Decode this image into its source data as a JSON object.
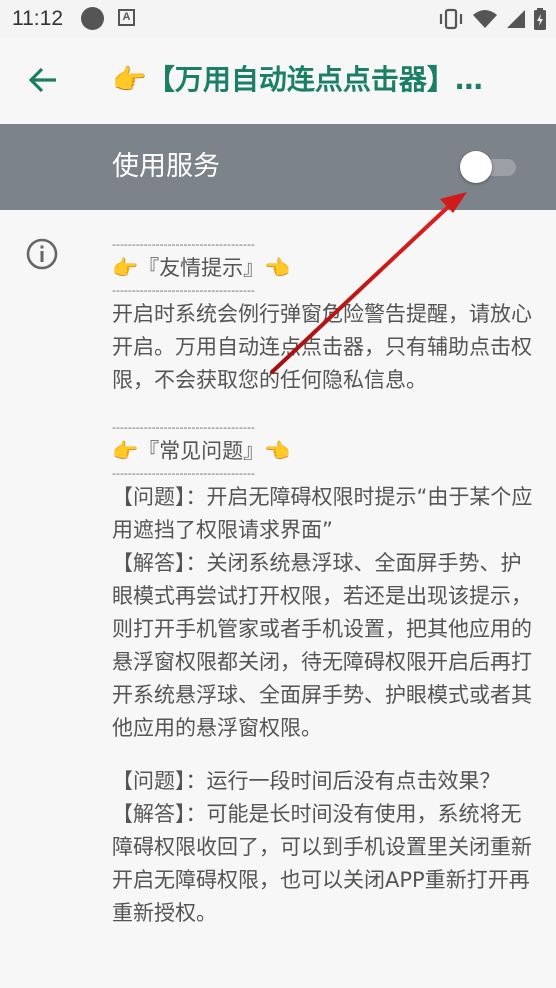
{
  "status_bar": {
    "time": "11:12",
    "icons": [
      "circle-notification-icon",
      "a-notification-icon",
      "vibrate-icon",
      "wifi-icon",
      "signal-icon",
      "battery-icon"
    ]
  },
  "app_bar": {
    "title": "👉【万用自动连点点击器】…",
    "back_icon": "arrow-back-icon"
  },
  "service": {
    "label": "使用服务",
    "enabled": false
  },
  "content": {
    "separator": "------------------------------------",
    "tip_heading": "👉『友情提示』👈",
    "tip_text": " 开启时系统会例行弹窗危险警告提醒，请放心开启。万用自动连点点击器，只有辅助点击权限，不会获取您的任何隐私信息。",
    "faq_heading": "👉『常见问题』👈",
    "faq1_q": " 【问题】：开启无障碍权限时提示“由于某个应用遮挡了权限请求界面”",
    "faq1_a": " 【解答】：关闭系统悬浮球、全面屏手势、护眼模式再尝试打开权限，若还是出现该提示，则打开手机管家或者手机设置，把其他应用的悬浮窗权限都关闭，待无障碍权限开启后再打开系统悬浮球、全面屏手势、护眼模式或者其他应用的悬浮窗权限。",
    "faq2_q": " 【问题】：运行一段时间后没有点击效果？",
    "faq2_a": " 【解答】：可能是长时间没有使用，系统将无障碍权限收回了，可以到手机设置里关闭重新开启无障碍权限，也可以关闭APP重新打开再重新授权。"
  },
  "colors": {
    "accent": "#1a7f64",
    "band": "#7d838a",
    "arrow": "#d11a1a"
  }
}
